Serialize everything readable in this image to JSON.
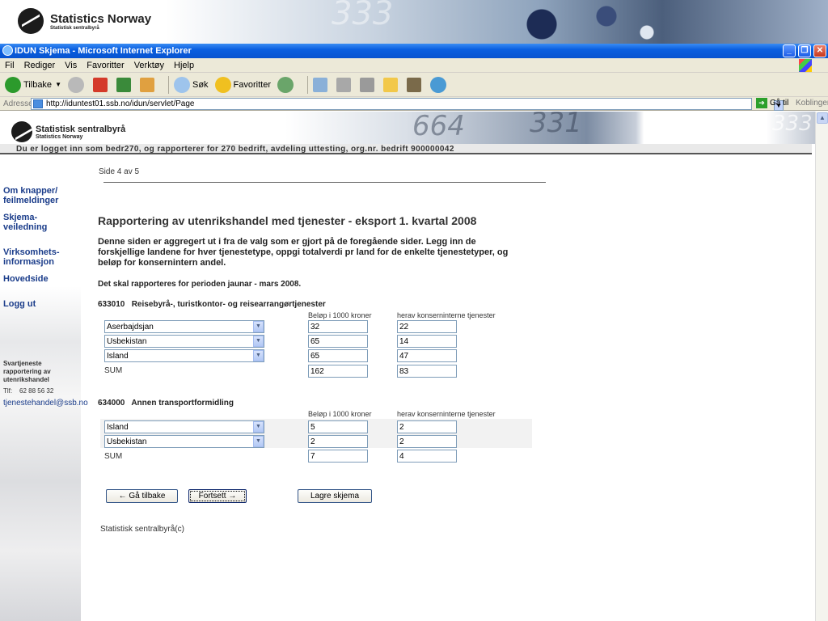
{
  "banner": {
    "logo_big": "Statistics Norway",
    "logo_small": "Statistisk sentralbyrå",
    "digits": "333"
  },
  "window": {
    "title": "IDUN Skjema - Microsoft Internet Explorer",
    "min": "_",
    "max": "❐",
    "close": "✕"
  },
  "menu": [
    "Fil",
    "Rediger",
    "Vis",
    "Favoritter",
    "Verktøy",
    "Hjelp"
  ],
  "toolbar": {
    "back": "Tilbake",
    "search": "Søk",
    "favorites": "Favoritter"
  },
  "address": {
    "label": "Adresse",
    "url": "http://iduntest01.ssb.no/idun/servlet/Page",
    "go": "Gå til",
    "links": "Koblinger"
  },
  "site": {
    "logo_big": "Statistisk sentralbyrå",
    "logo_small": "Statistics Norway",
    "digits1": "664",
    "digits2": "331",
    "digits3": "333",
    "login_line": "Du er logget inn som bedr270, og rapporterer for 270 bedrift, avdeling uttesting, org.nr. bedrift 900000042"
  },
  "nav": {
    "help_buttons": "Om knapper/\nfeilmeldinger",
    "guide": "Skjema-\nveiledning",
    "company": "Virksomhets-\ninformasjon",
    "home": "Hovedside",
    "logout": "Logg ut",
    "contact_title": "Svartjeneste\nrapportering av\nutenrikshandel",
    "phone": "Tlf:    62 88 56 32",
    "email": "tjenestehandel@ssb.no"
  },
  "page": {
    "side": "Side 4 av 5",
    "title": "Rapportering av utenrikshandel med tjenester - eksport 1. kvartal 2008",
    "lead": "Denne siden er aggregert ut i fra de valg som er gjort på de foregående sider. Legg inn de forskjellige landene for hver tjenestetype, oppgi totalverdi pr land for de enkelte tjenestetyper, og beløp for konsernintern andel.",
    "period": "Det skal rapporteres for perioden jaunar - mars 2008.",
    "col_amount": "Beløp i 1000 kroner",
    "col_intra": "herav konserninterne tjenester",
    "sum_label": "SUM",
    "sections": [
      {
        "code": "633010   Reisebyrå-, turistkontor- og reisearrangørtjenester",
        "rows": [
          {
            "country": "Aserbajdsjan",
            "amount": "32",
            "intra": "22"
          },
          {
            "country": "Usbekistan",
            "amount": "65",
            "intra": "14"
          },
          {
            "country": "Island",
            "amount": "65",
            "intra": "47"
          }
        ],
        "sum_amount": "162",
        "sum_intra": "83"
      },
      {
        "code": "634000   Annen transportformidling",
        "rows": [
          {
            "country": "Island",
            "amount": "5",
            "intra": "2"
          },
          {
            "country": "Usbekistan",
            "amount": "2",
            "intra": "2"
          }
        ],
        "sum_amount": "7",
        "sum_intra": "4"
      }
    ],
    "btn_back": "← Gå tilbake",
    "btn_next": "Fortsett →",
    "btn_save": "Lagre skjema",
    "footer": "Statistisk sentralbyrå(c)"
  }
}
